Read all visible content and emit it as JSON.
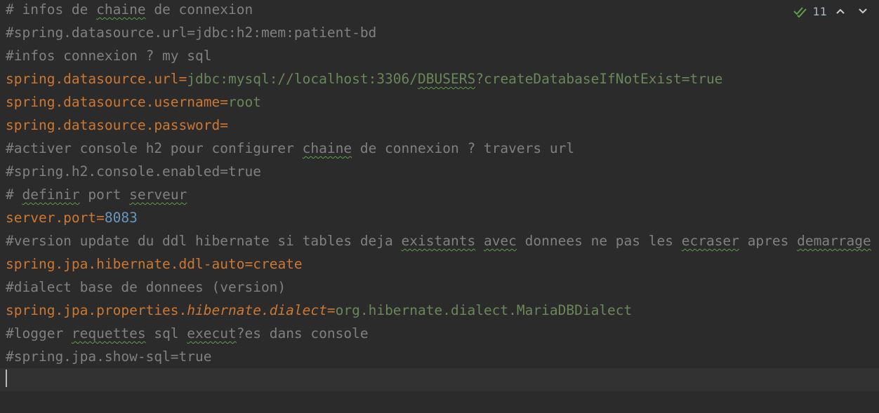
{
  "inspection": {
    "count": "11",
    "check_icon": "double-check-icon",
    "up_icon": "chevron-up-icon",
    "down_icon": "chevron-down-icon",
    "check_color": "#5c9e49"
  },
  "lines": [
    {
      "segments": [
        {
          "t": "# infos de ",
          "c": "comment"
        },
        {
          "t": "chaine",
          "c": "comment typo"
        },
        {
          "t": " de connexion",
          "c": "comment"
        }
      ]
    },
    {
      "segments": [
        {
          "t": "#spring.datasource.url=jdbc:h2:mem:patient-bd",
          "c": "comment"
        }
      ]
    },
    {
      "segments": [
        {
          "t": "#infos connexion ? my sql",
          "c": "comment"
        }
      ]
    },
    {
      "segments": [
        {
          "t": "spring.datasource.url",
          "c": "key"
        },
        {
          "t": "=",
          "c": "eq"
        },
        {
          "t": "jdbc:mysql://localhost:3306/",
          "c": "val"
        },
        {
          "t": "DBUSERS",
          "c": "val typo"
        },
        {
          "t": "?createDatabaseIfNotExist=true",
          "c": "val"
        }
      ]
    },
    {
      "segments": [
        {
          "t": "spring.datasource.username",
          "c": "key"
        },
        {
          "t": "=",
          "c": "eq"
        },
        {
          "t": "root",
          "c": "val"
        }
      ]
    },
    {
      "segments": [
        {
          "t": "spring.datasource.password",
          "c": "key"
        },
        {
          "t": "=",
          "c": "eq"
        }
      ]
    },
    {
      "segments": [
        {
          "t": "#activer console h2 pour configurer ",
          "c": "comment"
        },
        {
          "t": "chaine",
          "c": "comment typo"
        },
        {
          "t": " de connexion ? travers url",
          "c": "comment"
        }
      ]
    },
    {
      "segments": [
        {
          "t": "#spring.h2.console.enabled=true",
          "c": "comment"
        }
      ]
    },
    {
      "segments": [
        {
          "t": "# ",
          "c": "comment"
        },
        {
          "t": "definir",
          "c": "comment typo"
        },
        {
          "t": " port ",
          "c": "comment"
        },
        {
          "t": "serveur",
          "c": "comment typo"
        }
      ]
    },
    {
      "segments": [
        {
          "t": "server.port",
          "c": "key"
        },
        {
          "t": "=",
          "c": "eq"
        },
        {
          "t": "8083",
          "c": "num"
        }
      ]
    },
    {
      "segments": [
        {
          "t": "#version update du ddl hibernate si tables deja ",
          "c": "comment"
        },
        {
          "t": "existants",
          "c": "comment typo"
        },
        {
          "t": " ",
          "c": "comment"
        },
        {
          "t": "avec",
          "c": "comment typo"
        },
        {
          "t": " donnees ne pas les ",
          "c": "comment"
        },
        {
          "t": "ecraser",
          "c": "comment typo"
        },
        {
          "t": " apres ",
          "c": "comment"
        },
        {
          "t": "demarrage",
          "c": "comment typo"
        }
      ]
    },
    {
      "segments": [
        {
          "t": "spring.jpa.hibernate.ddl-auto",
          "c": "key"
        },
        {
          "t": "=",
          "c": "eq"
        },
        {
          "t": "create",
          "c": "key"
        }
      ]
    },
    {
      "segments": [
        {
          "t": "#dialect base de donnees (version)",
          "c": "comment"
        }
      ]
    },
    {
      "segments": [
        {
          "t": "spring.jpa.properties.",
          "c": "key"
        },
        {
          "t": "hibernate.dialect",
          "c": "key-italic"
        },
        {
          "t": "=",
          "c": "eq"
        },
        {
          "t": "org.hibernate.dialect.MariaDBDialect",
          "c": "val"
        }
      ]
    },
    {
      "segments": [
        {
          "t": "#logger ",
          "c": "comment"
        },
        {
          "t": "requettes",
          "c": "comment typo"
        },
        {
          "t": " sql ",
          "c": "comment"
        },
        {
          "t": "execut",
          "c": "comment typo"
        },
        {
          "t": "?es dans console",
          "c": "comment"
        }
      ]
    },
    {
      "segments": [
        {
          "t": "#spring.jpa.show-sql=true",
          "c": "comment"
        }
      ]
    },
    {
      "segments": [],
      "current": true
    }
  ]
}
